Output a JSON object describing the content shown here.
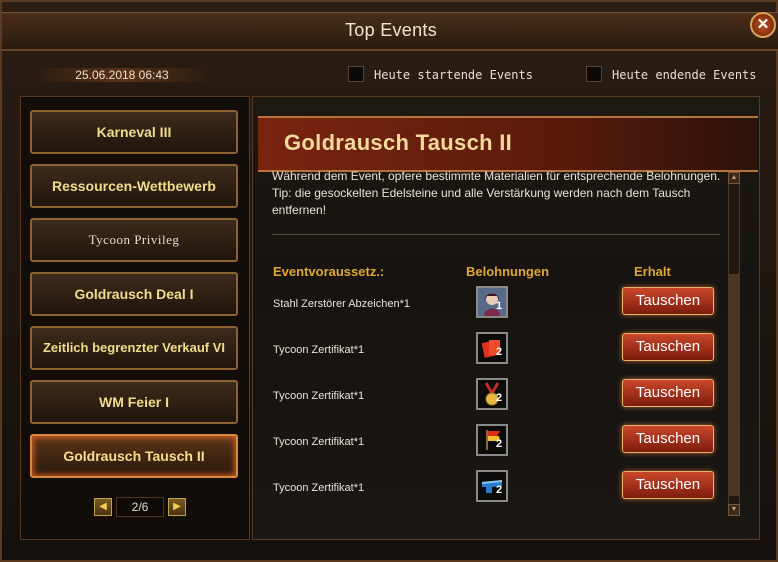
{
  "window": {
    "title": "Top Events",
    "close_label": "✕"
  },
  "header": {
    "datetime": "25.06.2018 06:43",
    "filter_today_start": "Heute startende Events",
    "filter_today_end": "Heute endende Events"
  },
  "sidebar": {
    "events": [
      "Karneval III",
      "Ressourcen-Wettbewerb",
      "Tycoon Privileg",
      "Goldrausch Deal I",
      "Zeitlich begrenzter Verkauf VI",
      "WM Feier I",
      "Goldrausch Tausch II"
    ],
    "selected_index": 6,
    "pager": {
      "page": "2/6",
      "prev_icon": "◀",
      "next_icon": "▶"
    }
  },
  "detail": {
    "title": "Goldrausch Tausch II",
    "description": "Während dem Event, opfere bestimmte Materialien für entsprechende Belohnungen. Tip: die gesockelten Edelsteine und alle Verstärkung werden nach dem Tausch entfernen!",
    "columns": {
      "requirement": "Eventvoraussetz.:",
      "reward": "Belohnungen",
      "obtain": "Erhalt"
    },
    "rows": [
      {
        "requirement": "Stahl Zerstörer Abzeichen*1",
        "reward_icon": "portrait-icon",
        "qty": "1",
        "button": "Tauschen"
      },
      {
        "requirement": "Tycoon Zertifikat*1",
        "reward_icon": "red-cards-icon",
        "qty": "2",
        "button": "Tauschen"
      },
      {
        "requirement": "Tycoon Zertifikat*1",
        "reward_icon": "medal-icon",
        "qty": "2",
        "button": "Tauschen"
      },
      {
        "requirement": "Tycoon Zertifikat*1",
        "reward_icon": "flag-icon",
        "qty": "2",
        "button": "Tauschen"
      },
      {
        "requirement": "Tycoon Zertifikat*1",
        "reward_icon": "blue-ticket-icon",
        "qty": "2",
        "button": "Tauschen"
      }
    ]
  },
  "colors": {
    "accent_gold": "#dea830",
    "button_red": "#c9472a",
    "banner_red": "#7a2410"
  }
}
